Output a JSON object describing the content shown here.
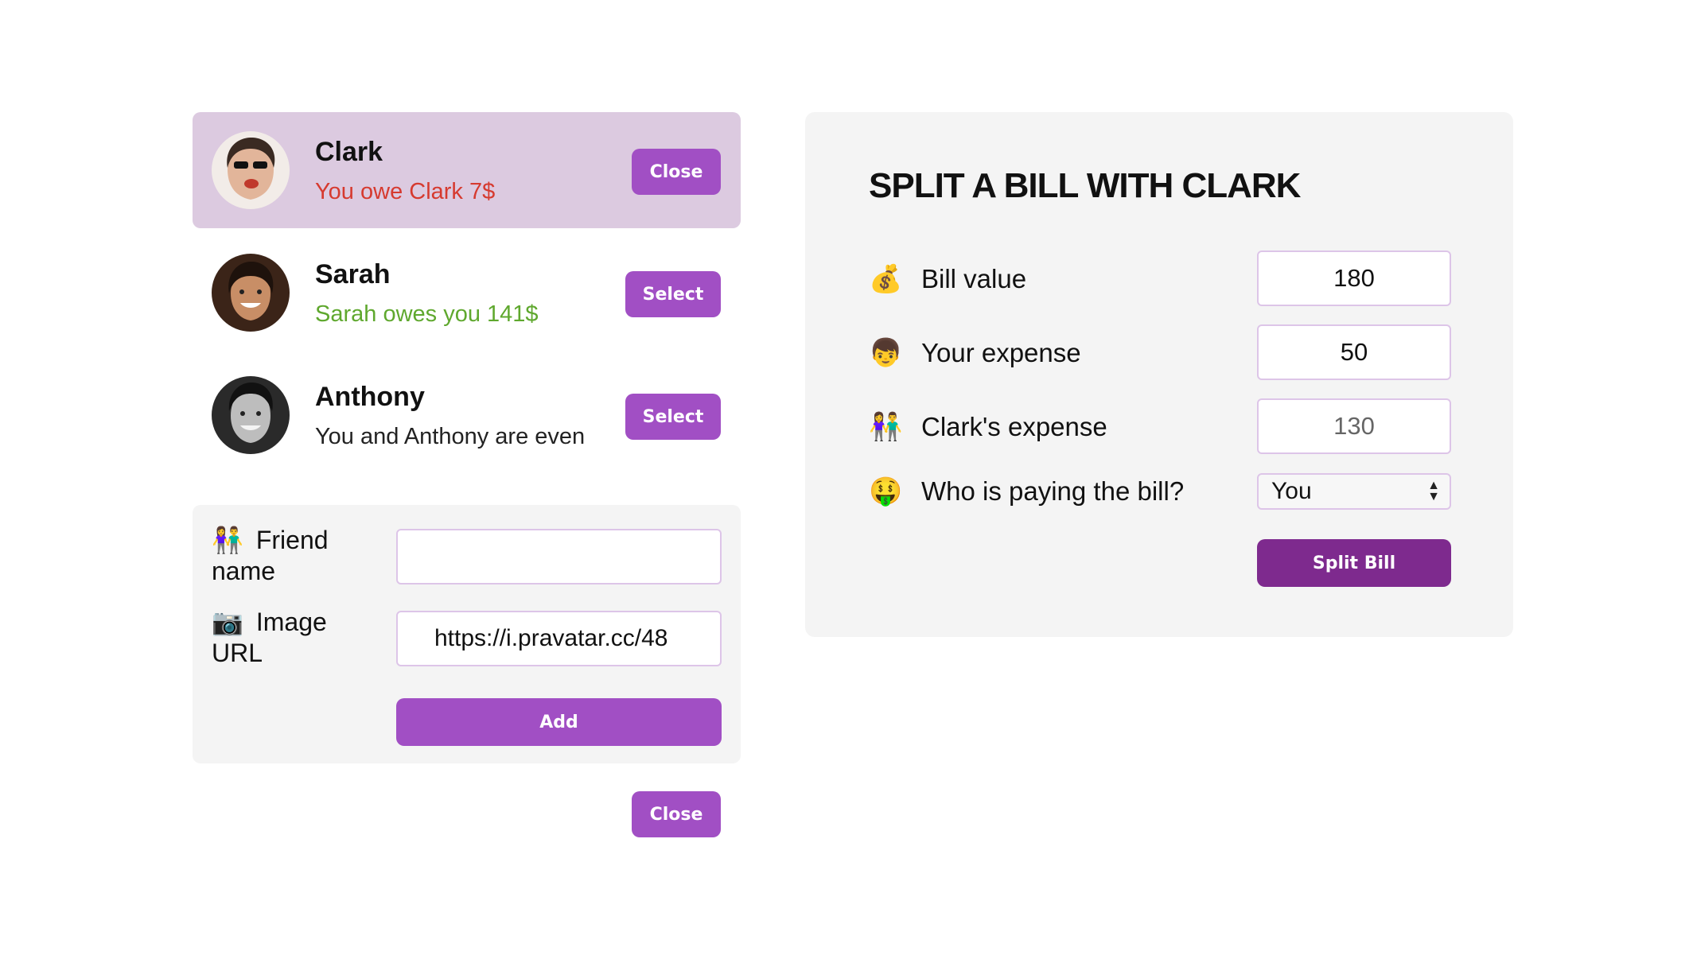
{
  "friends": [
    {
      "name": "Clark",
      "status": "You owe Clark 7$",
      "status_type": "negative",
      "button": "Close",
      "selected": true
    },
    {
      "name": "Sarah",
      "status": "Sarah owes you 141$",
      "status_type": "positive",
      "button": "Select",
      "selected": false
    },
    {
      "name": "Anthony",
      "status": "You and Anthony are even",
      "status_type": "even",
      "button": "Select",
      "selected": false
    }
  ],
  "add_form": {
    "name_emoji": "👫",
    "name_label": "Friend name",
    "name_value": "",
    "image_emoji": "📷",
    "image_label": "Image URL",
    "image_value": "https://i.pravatar.cc/48",
    "add_button": "Add"
  },
  "close_button": "Close",
  "split": {
    "title": "SPLIT A BILL WITH CLARK",
    "bill_emoji": "💰",
    "bill_label": "Bill value",
    "bill_value": "180",
    "your_emoji": "👦",
    "your_label": "Your expense",
    "your_value": "50",
    "friend_emoji": "👫",
    "friend_label": "Clark's expense",
    "friend_value": "130",
    "payer_emoji": "🤑",
    "payer_label": "Who is paying the bill?",
    "payer_value": "You",
    "split_button": "Split Bill"
  },
  "colors": {
    "accent": "#a14fc4",
    "selected_row": "#dccae0",
    "owe": "#d63a2f",
    "owed": "#5fa82e",
    "panel": "#f4f4f4",
    "split_button": "#7e2a8e"
  }
}
